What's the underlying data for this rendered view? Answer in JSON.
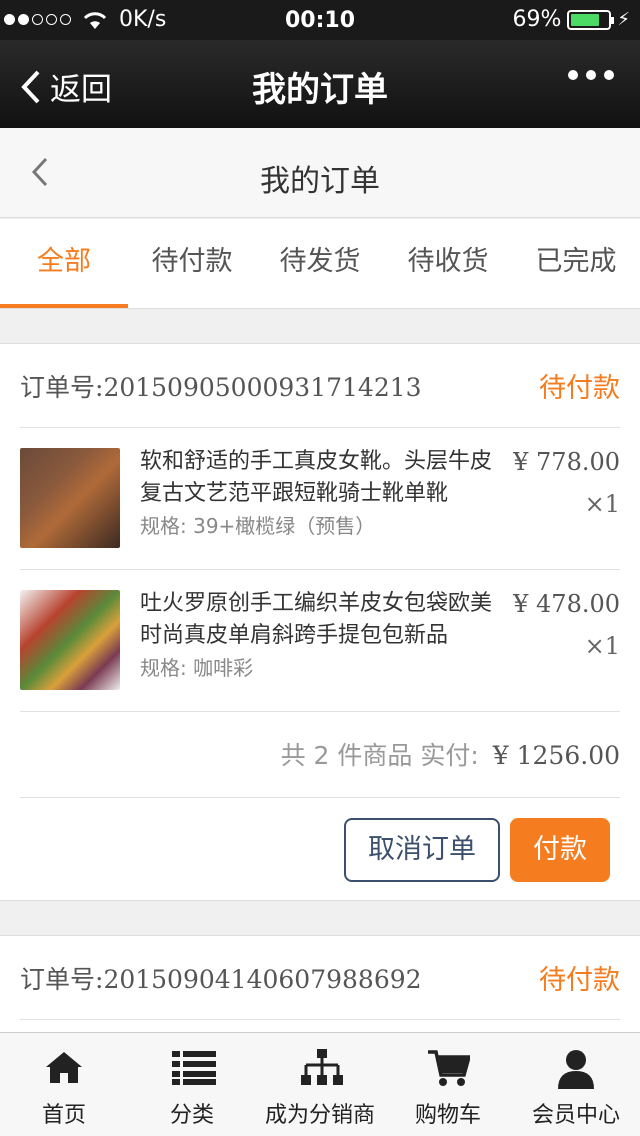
{
  "status": {
    "network": "0K/s",
    "time": "00:10",
    "battery": "69%"
  },
  "nav": {
    "back": "返回",
    "title": "我的订单"
  },
  "subheader": {
    "title": "我的订单"
  },
  "tabs": [
    {
      "label": "全部"
    },
    {
      "label": "待付款"
    },
    {
      "label": "待发货"
    },
    {
      "label": "待收货"
    },
    {
      "label": "已完成"
    }
  ],
  "orders": [
    {
      "label": "订单号:",
      "number": "20150905000931714213",
      "status": "待付款",
      "items": [
        {
          "name": "软和舒适的手工真皮女靴。头层牛皮复古文艺范平跟短靴骑士靴单靴",
          "spec": "规格: 39+橄榄绿（预售）",
          "price": "¥ 778.00",
          "qty": "×1"
        },
        {
          "name": "吐火罗原创手工编织羊皮女包袋欧美时尚真皮单肩斜跨手提包包新品",
          "spec": "规格: 咖啡彩",
          "price": "¥ 478.00",
          "qty": "×1"
        }
      ],
      "summary": "共 2 件商品 实付:",
      "total": "¥ 1256.00",
      "cancel": "取消订单",
      "pay": "付款"
    },
    {
      "label": "订单号:",
      "number": "20150904140607988692",
      "status": "待付款"
    }
  ],
  "bottom_nav": [
    {
      "label": "首页",
      "icon": "home-icon"
    },
    {
      "label": "分类",
      "icon": "list-icon"
    },
    {
      "label": "成为分销商",
      "icon": "sitemap-icon"
    },
    {
      "label": "购物车",
      "icon": "cart-icon"
    },
    {
      "label": "会员中心",
      "icon": "user-icon"
    }
  ],
  "colors": {
    "accent": "#f57c1f",
    "cancel_border": "#3c4f6c"
  }
}
